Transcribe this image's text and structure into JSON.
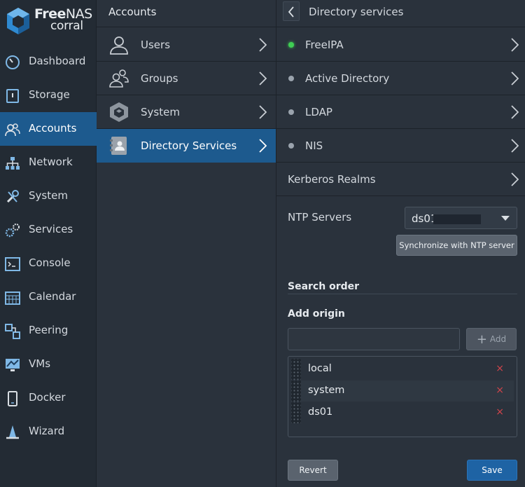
{
  "logo": {
    "line1_bold": "Free",
    "line1_rest": "NAS",
    "line2": "corral"
  },
  "nav": {
    "items": [
      {
        "label": "Dashboard",
        "icon": "gauge-icon"
      },
      {
        "label": "Storage",
        "icon": "storage-icon"
      },
      {
        "label": "Accounts",
        "icon": "users-icon",
        "active": true
      },
      {
        "label": "Network",
        "icon": "network-icon"
      },
      {
        "label": "System",
        "icon": "tools-icon"
      },
      {
        "label": "Services",
        "icon": "gears-icon"
      },
      {
        "label": "Console",
        "icon": "terminal-icon"
      },
      {
        "label": "Calendar",
        "icon": "calendar-icon"
      },
      {
        "label": "Peering",
        "icon": "peering-icon"
      },
      {
        "label": "VMs",
        "icon": "monitor-icon"
      },
      {
        "label": "Docker",
        "icon": "phone-icon"
      },
      {
        "label": "Wizard",
        "icon": "wizard-icon"
      }
    ]
  },
  "accounts": {
    "title": "Accounts",
    "items": [
      {
        "label": "Users",
        "icon": "user-icon"
      },
      {
        "label": "Groups",
        "icon": "group-icon"
      },
      {
        "label": "System",
        "icon": "cube-icon"
      },
      {
        "label": "Directory Services",
        "icon": "address-book-icon",
        "active": true
      }
    ]
  },
  "directory": {
    "title": "Directory services",
    "items": [
      {
        "label": "FreeIPA",
        "status": "on"
      },
      {
        "label": "Active Directory",
        "status": "off"
      },
      {
        "label": "LDAP",
        "status": "off"
      },
      {
        "label": "NIS",
        "status": "off"
      },
      {
        "label": "Kerberos Realms",
        "status": "none"
      }
    ],
    "ntp_label": "NTP Servers",
    "ntp_value": "ds01",
    "sync_label": "Synchronize with NTP server",
    "search_order_label": "Search order",
    "add_origin_label": "Add origin",
    "origin_input_value": "",
    "add_label": "Add",
    "origins": [
      "local",
      "system",
      "ds01"
    ],
    "remove_glyph": "×",
    "revert_label": "Revert",
    "save_label": "Save"
  },
  "colors": {
    "accent": "#1d5a8e",
    "save": "#1e63a4",
    "status_on": "#3fcf54",
    "remove": "#d2444b"
  }
}
